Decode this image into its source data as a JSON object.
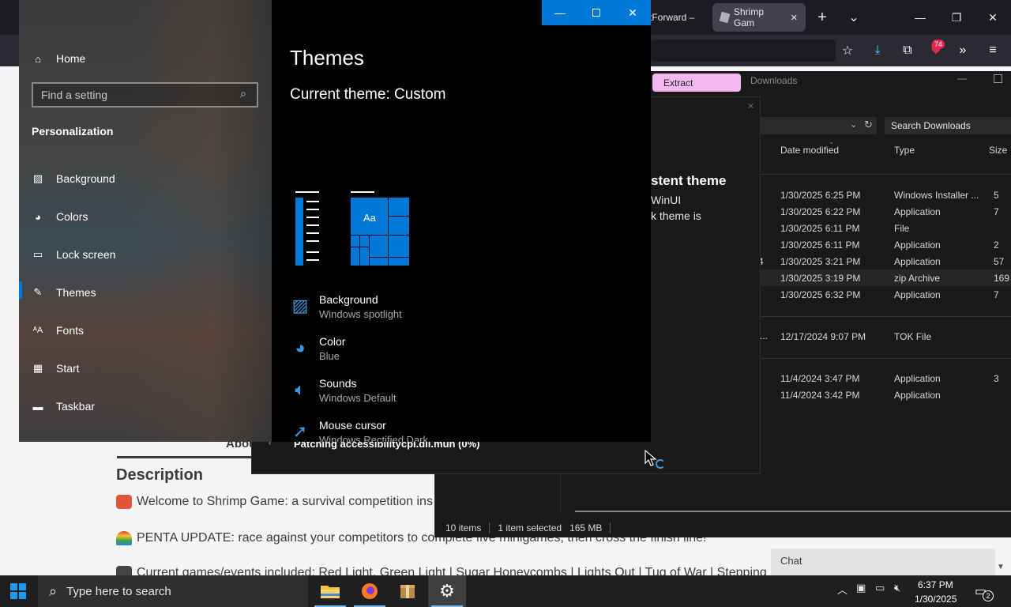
{
  "browser": {
    "tab_forward_label": "tForward – ",
    "tab_shrimp_label": "Shrimp Gam",
    "tab_close_glyph": "✕",
    "new_tab_glyph": "+",
    "tab_list_glyph": "⌄",
    "extension_badge": "74"
  },
  "page": {
    "about_tab": "Abou",
    "description_heading": "Description",
    "lines": [
      "Welcome to Shrimp Game: a survival competition ins",
      "PENTA UPDATE: race against your competitors to complete five minigames, then cross the finish line!",
      "Current games/events included: Red Light, Green Light | Sugar Honeycombs | Lights Out | Tug of War | Stepping"
    ],
    "chat_label": "Chat"
  },
  "explorer": {
    "extract_label": "Extract",
    "title": "Downloads",
    "search_placeholder": "Search Downloads",
    "columns": {
      "date": "Date modified",
      "type": "Type",
      "size": "Size"
    },
    "rows": [
      {
        "date": "1/30/2025 6:25 PM",
        "type": "Windows Installer ...",
        "size": "5"
      },
      {
        "date": "1/30/2025 6:22 PM",
        "type": "Application",
        "size": "7"
      },
      {
        "date": "1/30/2025 6:11 PM",
        "type": "File",
        "size": ""
      },
      {
        "date": "1/30/2025 6:11 PM",
        "type": "Application",
        "size": "2"
      },
      {
        "date": "1/30/2025 3:21 PM",
        "type": "Application",
        "size": "57"
      },
      {
        "date": "1/30/2025 3:19 PM",
        "type": "zip Archive",
        "size": "169"
      },
      {
        "date": "1/30/2025 6:32 PM",
        "type": "Application",
        "size": "7"
      },
      {
        "date": "12/17/2024 9:07 PM",
        "type": "TOK File",
        "size": ""
      },
      {
        "date": "11/4/2024 3:47 PM",
        "type": "Application",
        "size": "3"
      },
      {
        "date": "11/4/2024 3:42 PM",
        "type": "Application",
        "size": ""
      }
    ],
    "stray_4": "4",
    "stray_dots": "...",
    "status_items": "10 items",
    "status_selected": "1 item selected",
    "status_size": "165 MB"
  },
  "patcher": {
    "heading": "stent theme",
    "line1": "WinUI",
    "line2": "k theme is",
    "status": "Patching accessibilitycpl.dll.mun (0%)"
  },
  "settings": {
    "home": "Home",
    "search_placeholder": "Find a setting",
    "section": "Personalization",
    "nav": [
      {
        "label": "Background",
        "icon": "picture-icon"
      },
      {
        "label": "Colors",
        "icon": "palette-icon"
      },
      {
        "label": "Lock screen",
        "icon": "lock-screen-icon"
      },
      {
        "label": "Themes",
        "icon": "themes-icon"
      },
      {
        "label": "Fonts",
        "icon": "fonts-icon"
      },
      {
        "label": "Start",
        "icon": "start-icon"
      },
      {
        "label": "Taskbar",
        "icon": "taskbar-icon"
      }
    ],
    "selected_nav": "Themes",
    "title": "Themes",
    "current_theme": "Current theme: Custom",
    "preview_tile_text": "Aa",
    "options": [
      {
        "title": "Background",
        "value": "Windows spotlight"
      },
      {
        "title": "Color",
        "value": "Blue"
      },
      {
        "title": "Sounds",
        "value": "Windows Default"
      },
      {
        "title": "Mouse cursor",
        "value": "Windows Rectified Dark"
      }
    ]
  },
  "taskbar": {
    "search_placeholder": "Type here to search",
    "time": "6:37 PM",
    "date": "1/30/2025",
    "notification_count": "2"
  },
  "colors": {
    "accent": "#0078d7",
    "extract_pink": "#f4b8f0",
    "dark_bg": "#191919"
  }
}
